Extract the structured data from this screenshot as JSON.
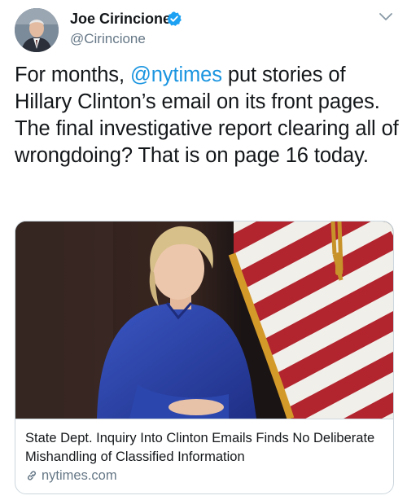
{
  "author": {
    "display_name": "Joe Cirincione",
    "handle": "@Cirincione",
    "verified": true,
    "avatar_icon": "profile-photo"
  },
  "menu_icon": "chevron-down-icon",
  "tweet": {
    "text_before": "For months, ",
    "mention": "@nytimes",
    "text_after": " put stories of Hillary Clinton’s email on its front pages. The final investigative report clearing all of wrongdoing? That is on page 16 today."
  },
  "card": {
    "image_icon": "article-photo",
    "title": "State Dept. Inquiry Into Clinton Emails Finds No Deliberate Mishandling of Classified Information",
    "domain": "nytimes.com",
    "link_icon": "link-icon"
  },
  "colors": {
    "link": "#1b95e0",
    "secondary_text": "#657786",
    "verified_badge": "#1da1f2",
    "border": "#ccd6dd"
  }
}
